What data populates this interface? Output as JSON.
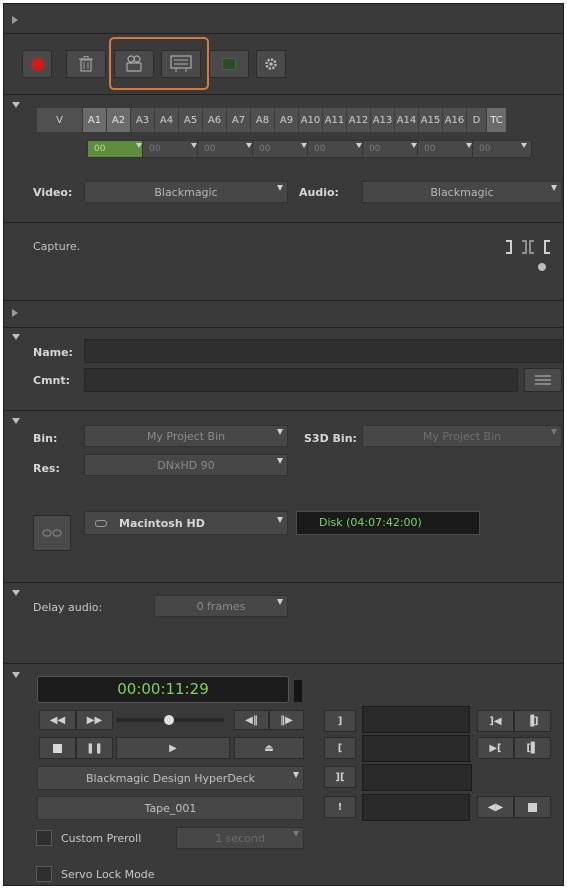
{
  "toolbar": {
    "icons": [
      "record-icon",
      "trash-icon",
      "capture-group-icon",
      "capture-log-icon",
      "toggle-icon",
      "gear-icon"
    ]
  },
  "tracks": {
    "labels": [
      "V",
      "A1",
      "A2",
      "A3",
      "A4",
      "A5",
      "A6",
      "A7",
      "A8",
      "A9",
      "A10",
      "A11",
      "A12",
      "A13",
      "A14",
      "A15",
      "A16",
      "D",
      "TC"
    ],
    "active": [
      "A1",
      "A2",
      "TC"
    ],
    "pairs": [
      "00",
      "00",
      "00",
      "00",
      "00",
      "00",
      "00",
      "00"
    ]
  },
  "source": {
    "video_label": "Video:",
    "video_value": "Blackmagic",
    "audio_label": "Audio:",
    "audio_value": "Blackmagic"
  },
  "capture": {
    "status": "Capture."
  },
  "clip": {
    "name_label": "Name:",
    "name_value": "",
    "comment_label": "Cmnt:",
    "comment_value": ""
  },
  "target": {
    "bin_label": "Bin:",
    "bin_value": "My Project Bin",
    "s3d_label": "S3D Bin:",
    "s3d_value": "My Project Bin",
    "res_label": "Res:",
    "res_value": "DNxHD 90",
    "drive_value": "Macintosh HD",
    "disk_status": "Disk (04:07:42:00)"
  },
  "audio_delay": {
    "label": "Delay audio:",
    "value": "0 frames"
  },
  "deck": {
    "timecode": "00:00:11:29",
    "device": "Blackmagic Design HyperDeck",
    "tape": "Tape_001",
    "preroll_label": "Custom Preroll",
    "preroll_value": "1 second",
    "servo_label": "Servo Lock Mode"
  },
  "colors": {
    "panel": "#3a3a3a",
    "record": "#d21a1a",
    "highlight": "#d87a3a",
    "timecode_green": "#7ed35a",
    "disk_green": "#7cd46a"
  }
}
